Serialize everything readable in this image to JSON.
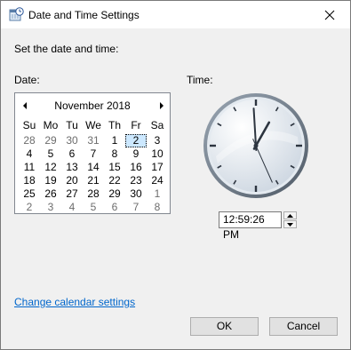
{
  "window": {
    "title": "Date and Time Settings",
    "app_icon": "date-time-settings-icon",
    "close_icon": "close-icon"
  },
  "heading": "Set the date and time:",
  "date_label": "Date:",
  "time_label": "Time:",
  "calendar": {
    "month_title": "November 2018",
    "prev_icon": "chevron-left-icon",
    "next_icon": "chevron-right-icon",
    "days_of_week": [
      "Su",
      "Mo",
      "Tu",
      "We",
      "Th",
      "Fr",
      "Sa"
    ],
    "weeks": [
      [
        "28",
        "29",
        "30",
        "31",
        "1",
        "2",
        "3"
      ],
      [
        "4",
        "5",
        "6",
        "7",
        "8",
        "9",
        "10"
      ],
      [
        "11",
        "12",
        "13",
        "14",
        "15",
        "16",
        "17"
      ],
      [
        "18",
        "19",
        "20",
        "21",
        "22",
        "23",
        "24"
      ],
      [
        "25",
        "26",
        "27",
        "28",
        "29",
        "30",
        "1"
      ],
      [
        "2",
        "3",
        "4",
        "5",
        "6",
        "7",
        "8"
      ]
    ],
    "selected_day": "2"
  },
  "clock": {
    "hour": 12,
    "minute": 59,
    "second": 26
  },
  "time_value": "12:59:26 PM",
  "spin_up_icon": "spin-up-icon",
  "spin_down_icon": "spin-down-icon",
  "link": "Change calendar settings",
  "buttons": {
    "ok": "OK",
    "cancel": "Cancel"
  },
  "colors": {
    "link": "#0066cc",
    "selection": "#cce8ff",
    "clock_face": "#eef3f8",
    "clock_rim": "#6a7480"
  }
}
